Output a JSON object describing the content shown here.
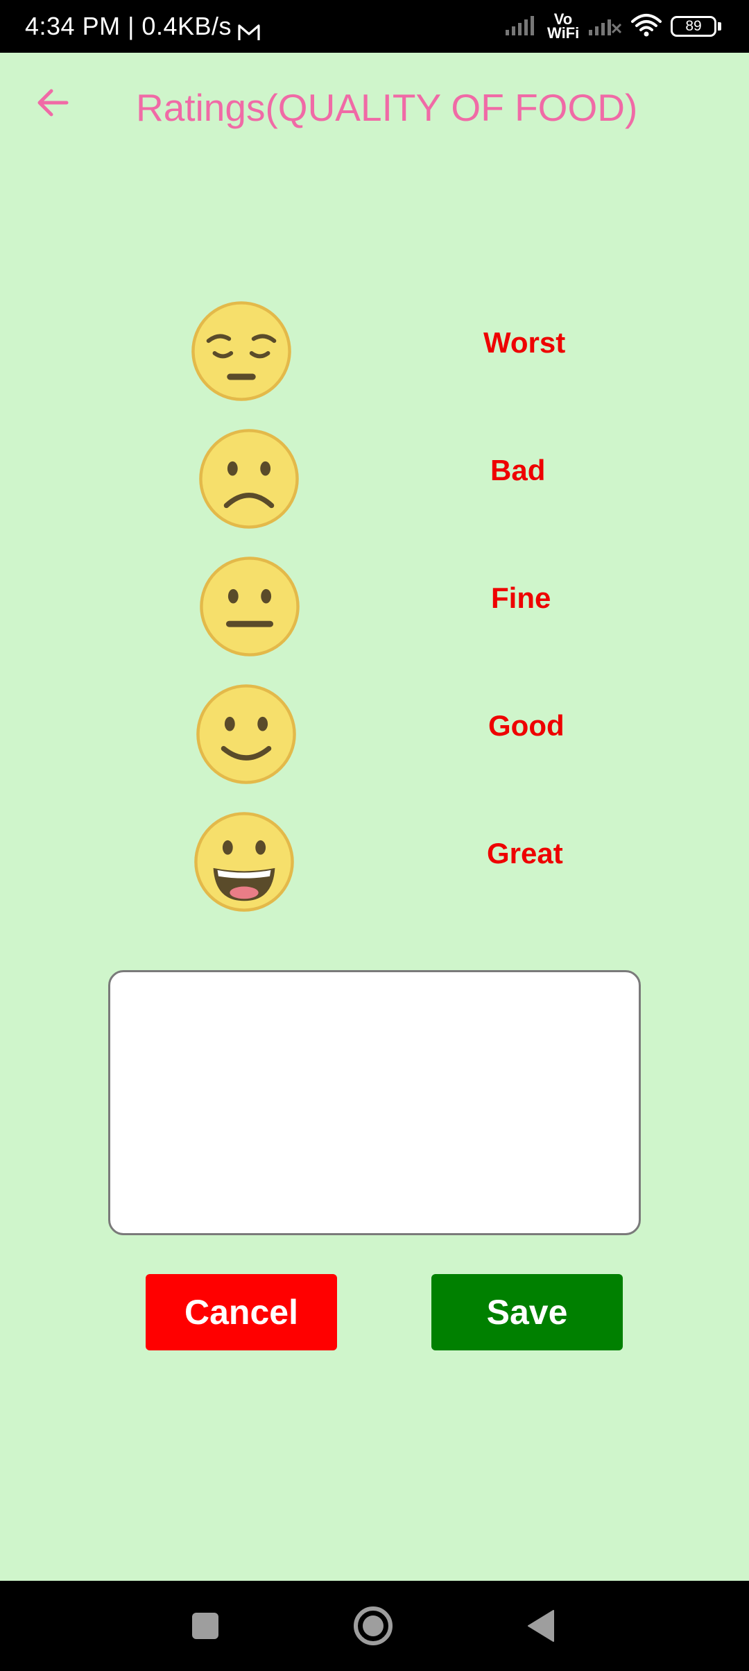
{
  "status_bar": {
    "time": "4:34 PM | 0.4KB/s",
    "network": "Vo WiFi",
    "battery": "89",
    "icons": [
      "gmail-icon",
      "signal-icon",
      "signal-off-icon",
      "wifi-icon",
      "battery-icon"
    ]
  },
  "header": {
    "title": "Ratings(QUALITY OF FOOD)",
    "back_icon": "arrow-left-icon"
  },
  "ratings": [
    {
      "label": "Worst",
      "icon": "pensive-face-icon"
    },
    {
      "label": "Bad",
      "icon": "frowning-face-icon"
    },
    {
      "label": "Fine",
      "icon": "neutral-face-icon"
    },
    {
      "label": "Good",
      "icon": "slightly-smiling-face-icon"
    },
    {
      "label": "Great",
      "icon": "grinning-face-icon"
    }
  ],
  "comment": {
    "value": "",
    "placeholder": ""
  },
  "buttons": {
    "cancel": "Cancel",
    "save": "Save"
  },
  "colors": {
    "background": "#cff5cb",
    "title": "#f06aa6",
    "rating_label": "#ee0000",
    "cancel": "#ff0000",
    "save": "#008000"
  },
  "nav_bar": {
    "icons": [
      "recents-square-icon",
      "home-circle-icon",
      "back-triangle-icon"
    ]
  }
}
